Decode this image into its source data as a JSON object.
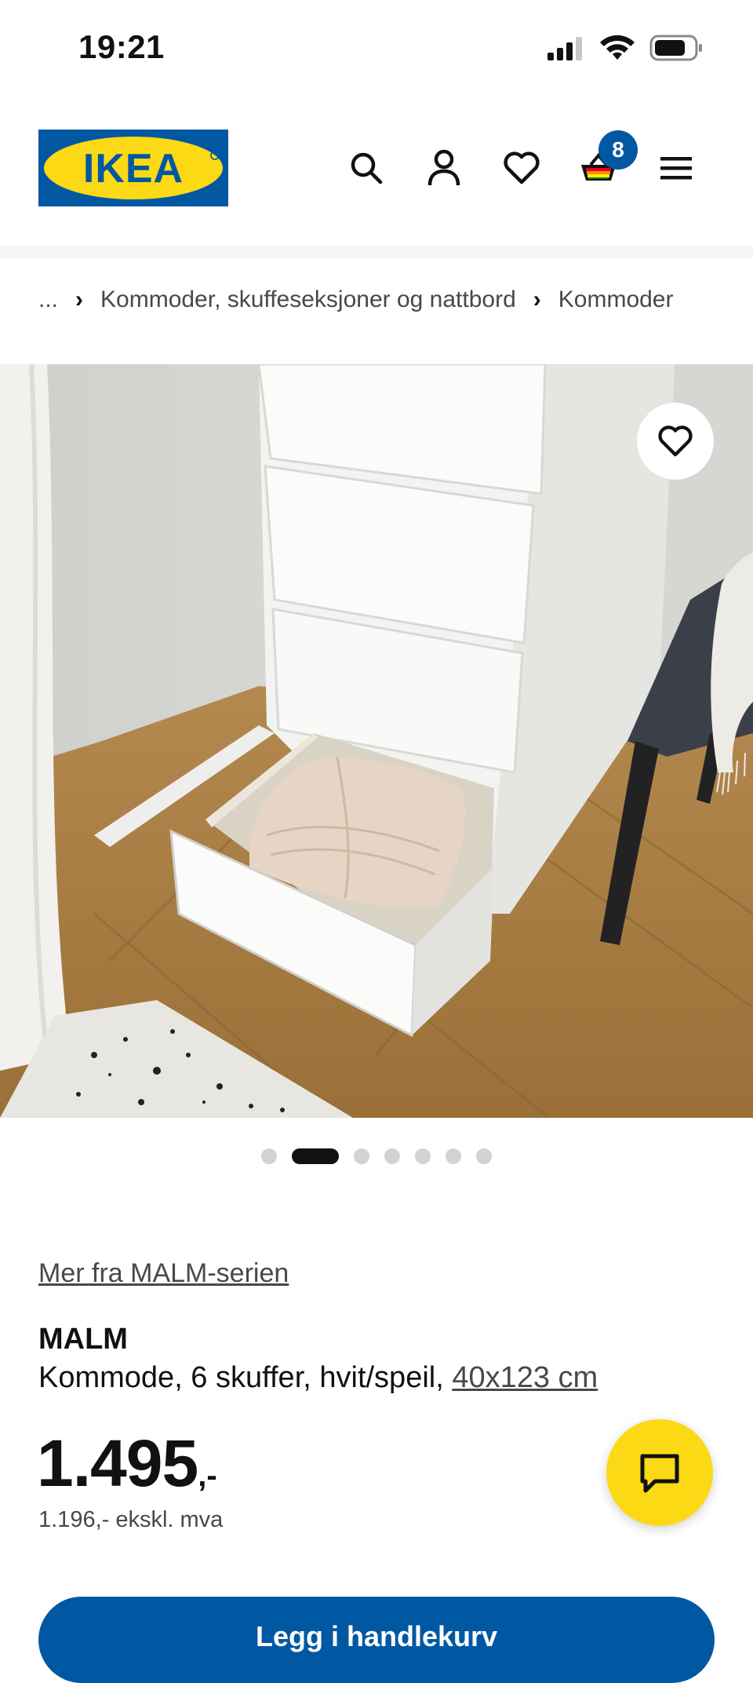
{
  "status_bar": {
    "time": "19:21",
    "icons": [
      "signal-icon",
      "wifi-icon",
      "battery-icon"
    ]
  },
  "header": {
    "logo_text": "IKEA",
    "icons": [
      "search-icon",
      "profile-icon",
      "heart-icon",
      "cart-icon",
      "menu-icon"
    ],
    "cart_count": "8"
  },
  "breadcrumb": {
    "items": [
      "...",
      "Kommoder, skuffeseksjoner og nattbord",
      "Kommoder"
    ]
  },
  "carousel": {
    "dot_count": 7,
    "active_index": 1
  },
  "product": {
    "series_link": "Mer fra MALM-serien",
    "name": "MALM",
    "description": "Kommode, 6 skuffer, hvit/speil, ",
    "size_link": "40x123 cm",
    "price": "1.495",
    "price_suffix": ",-",
    "price_ex_vat": "1.196,- ekskl. mva"
  },
  "cta": {
    "label": "Legg i handlekurv"
  },
  "colors": {
    "brand_blue": "#0058a3",
    "brand_yellow": "#fbd914"
  }
}
